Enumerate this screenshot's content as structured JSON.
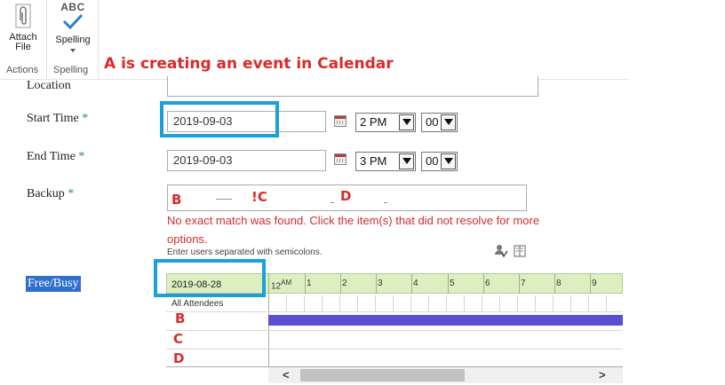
{
  "ribbon": {
    "attach_label_1": "Attach",
    "attach_label_2": "File",
    "spelling_label": "Spelling",
    "abc_text": "ABC",
    "group_actions": "Actions",
    "group_spelling": "Spelling"
  },
  "annotation_title": "A is creating an event in Calendar",
  "form": {
    "location_label": "Location",
    "start_label": "Start Time",
    "end_label": "End Time",
    "backup_label": "Backup",
    "required_mark": "*",
    "start_date": "2019-09-03",
    "start_hour": "2 PM",
    "start_min": "00",
    "end_date": "2019-09-03",
    "end_hour": "3 PM",
    "end_min": "00",
    "backup_letters": [
      "B",
      "!C",
      "D"
    ],
    "error_text": "No exact match was found. Click the item(s) that did not resolve for more options.",
    "hint_text": "Enter users separated with semicolons."
  },
  "freebusy": {
    "label": "Free/Busy",
    "date": "2019-08-28",
    "hours": [
      "12",
      "1",
      "2",
      "3",
      "4",
      "5",
      "6",
      "7",
      "8",
      "9"
    ],
    "am_mark": "AM",
    "all_attendees": "All Attendees",
    "attendee_letters": [
      "B",
      "C",
      "D"
    ]
  },
  "scrollbar": {
    "left_arrow": "<",
    "right_arrow": ">"
  },
  "colors": {
    "annotation_red": "#d92b2b",
    "highlight_blue": "#1aa0db",
    "busy": "#5a4fd1",
    "grid_green": "#dcefc0"
  }
}
